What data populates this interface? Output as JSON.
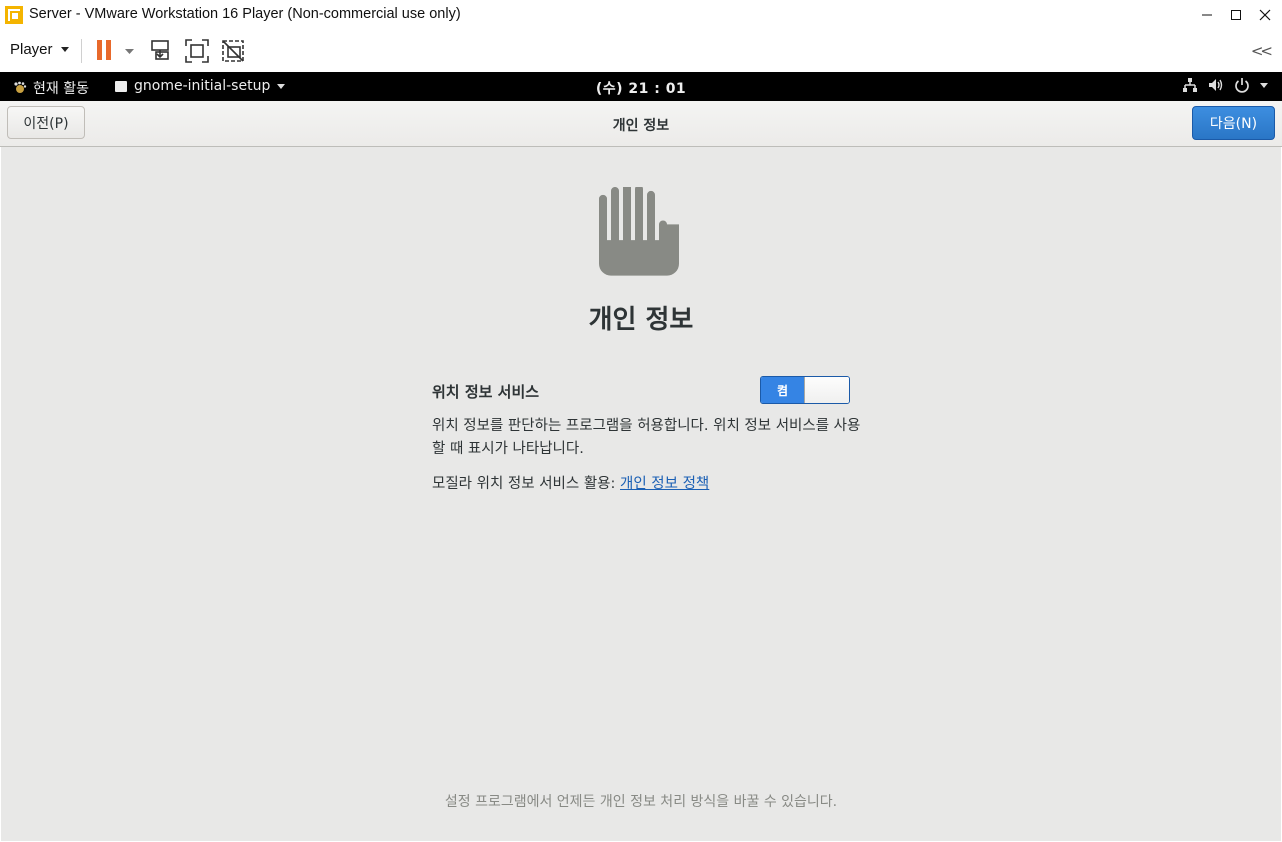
{
  "window": {
    "title": "Server - VMware Workstation 16 Player (Non-commercial use only)",
    "minimize": "—",
    "maximize": "☐",
    "close": "✕"
  },
  "toolbar": {
    "player_label": "Player",
    "collapse": "<<"
  },
  "gnome_bar": {
    "activities": "현재 활동",
    "app_name": "gnome-initial-setup",
    "clock": "(수) 21 : 01"
  },
  "header": {
    "prev_label": "이전(P)",
    "title": "개인 정보",
    "next_label": "다음(N)"
  },
  "main": {
    "heading": "개인 정보",
    "location_label": "위치 정보 서비스",
    "switch_on_label": "켬",
    "switch_state": true,
    "description": "위치 정보를 판단하는 프로그램을 허용합니다. 위치 정보 서비스를 사용할 때 표시가 나타납니다.",
    "policy_prefix": "모질라 위치 정보 서비스 활용: ",
    "policy_link": "개인 정보 정책",
    "footer": "설정 프로그램에서 언제든 개인 정보 처리 방식을 바꿀 수 있습니다."
  },
  "colors": {
    "accent": "#3584e4",
    "link": "#1a5fb4",
    "pause": "#e8692b",
    "content_bg": "#e8e8e7"
  },
  "icons": [
    "vmware-app-icon",
    "pause-icon",
    "send-ctrl-alt-del-icon",
    "fullscreen-icon",
    "unity-icon",
    "network-icon",
    "volume-icon",
    "power-icon",
    "privacy-hand-icon"
  ]
}
